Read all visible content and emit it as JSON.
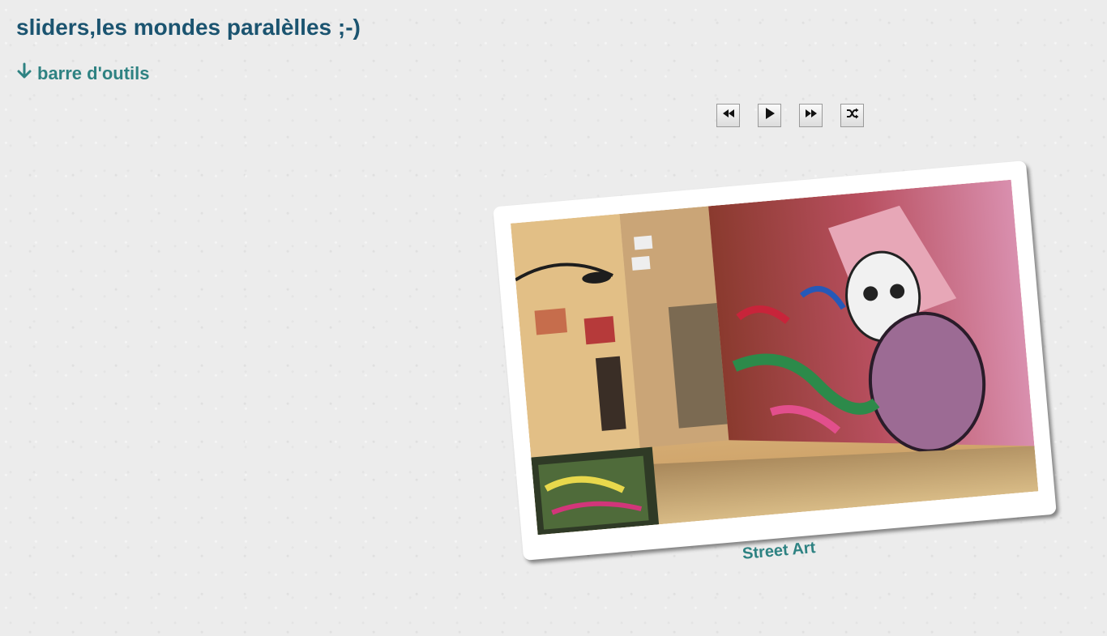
{
  "page": {
    "title": "sliders,les mondes paralèlles ;-)"
  },
  "toolbar_toggle": {
    "icon": "arrow-down-icon",
    "label": "barre d'outils"
  },
  "slider_controls": [
    {
      "name": "previous",
      "icon": "rewind-icon"
    },
    {
      "name": "play",
      "icon": "play-icon"
    },
    {
      "name": "next",
      "icon": "fast-forward-icon"
    },
    {
      "name": "shuffle",
      "icon": "shuffle-icon"
    }
  ],
  "slide": {
    "caption": "Street Art",
    "image_subject": "graffiti-covered alley"
  },
  "colors": {
    "title": "#1b5470",
    "accent": "#2e8282",
    "background": "#ececec"
  }
}
